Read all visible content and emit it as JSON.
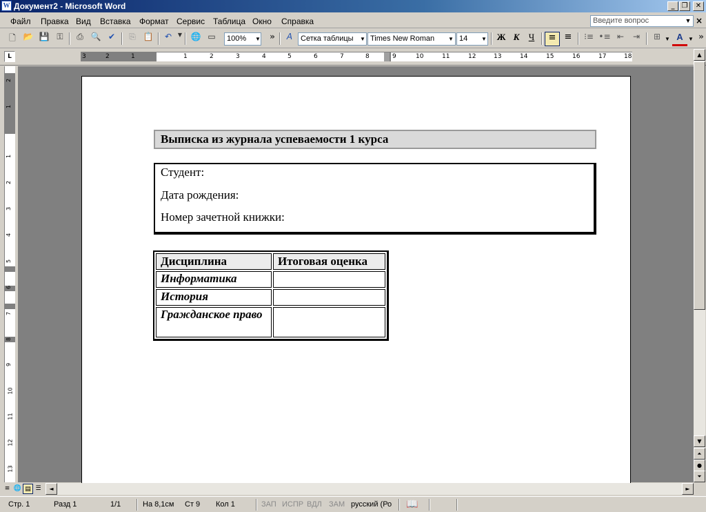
{
  "window": {
    "title": "Документ2 - Microsoft Word",
    "app_icon": "W",
    "minimize": "_",
    "restore": "❐",
    "close": "✕"
  },
  "menu": [
    "Файл",
    "Правка",
    "Вид",
    "Вставка",
    "Формат",
    "Сервис",
    "Таблица",
    "Окно",
    "Справка"
  ],
  "help_search": {
    "placeholder": "Введите вопрос"
  },
  "toolbar": {
    "zoom": "100%",
    "style": "Сетка таблицы",
    "font": "Times New Roman",
    "size": "14",
    "bold": "Ж",
    "italic": "К",
    "underline": "Ч",
    "overflow": "»"
  },
  "hruler": [
    "3",
    "2",
    "1",
    "1",
    "2",
    "3",
    "4",
    "5",
    "6",
    "7",
    "8",
    "9",
    "10",
    "11",
    "12",
    "13",
    "14",
    "15",
    "16",
    "17",
    "18"
  ],
  "vruler": [
    "2",
    "1",
    "1",
    "2",
    "3",
    "4",
    "5",
    "6",
    "7",
    "8",
    "9",
    "10",
    "11",
    "12",
    "13"
  ],
  "document": {
    "heading": "Выписка из журнала успеваемости 1 курса",
    "info_lines": [
      "Студент:",
      "Дата рождения:",
      "Номер зачетной книжки:"
    ],
    "table": {
      "headers": [
        "Дисциплина",
        "Итоговая оценка"
      ],
      "rows": [
        [
          "Информатика",
          ""
        ],
        [
          "История",
          ""
        ],
        [
          "Гражданское право",
          ""
        ]
      ]
    }
  },
  "status": {
    "page": "Стр. 1",
    "section": "Разд 1",
    "pages": "1/1",
    "at": "На 8,1см",
    "line": "Ст 9",
    "col": "Кол 1",
    "rec": "ЗАП",
    "trk": "ИСПР",
    "ext": "ВДЛ",
    "ovr": "ЗАМ",
    "language": "русский (Ро"
  }
}
